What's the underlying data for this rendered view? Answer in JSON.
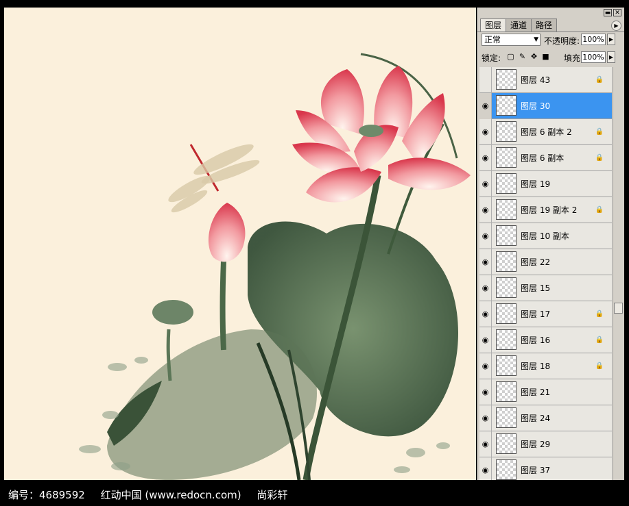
{
  "panel": {
    "tabs": [
      "图层",
      "通道",
      "路径"
    ],
    "blend_mode": "正常",
    "opacity_label": "不透明度:",
    "opacity_value": "100%",
    "lock_label": "锁定:",
    "fill_label": "填充:",
    "fill_value": "100%",
    "layers": [
      {
        "name": "图层 43",
        "visible": false,
        "selected": false,
        "locked": true
      },
      {
        "name": "图层 30",
        "visible": true,
        "selected": true,
        "locked": false
      },
      {
        "name": "图层 6 副本 2",
        "visible": true,
        "selected": false,
        "locked": true
      },
      {
        "name": "图层 6 副本",
        "visible": true,
        "selected": false,
        "locked": true
      },
      {
        "name": "图层 19",
        "visible": true,
        "selected": false,
        "locked": false
      },
      {
        "name": "图层 19 副本 2",
        "visible": true,
        "selected": false,
        "locked": true
      },
      {
        "name": "图层 10 副本",
        "visible": true,
        "selected": false,
        "locked": false
      },
      {
        "name": "图层 22",
        "visible": true,
        "selected": false,
        "locked": false
      },
      {
        "name": "图层 15",
        "visible": true,
        "selected": false,
        "locked": false
      },
      {
        "name": "图层 17",
        "visible": true,
        "selected": false,
        "locked": true
      },
      {
        "name": "图层 16",
        "visible": true,
        "selected": false,
        "locked": true
      },
      {
        "name": "图层 18",
        "visible": true,
        "selected": false,
        "locked": true
      },
      {
        "name": "图层 21",
        "visible": true,
        "selected": false,
        "locked": false
      },
      {
        "name": "图层 24",
        "visible": true,
        "selected": false,
        "locked": false
      },
      {
        "name": "图层 29",
        "visible": true,
        "selected": false,
        "locked": false
      },
      {
        "name": "图层 37",
        "visible": true,
        "selected": false,
        "locked": false
      }
    ]
  },
  "caption": {
    "id_text": "编号：4689592",
    "site_text": "红动中国 (www.redocn.com)",
    "author_text": "尚彩轩"
  },
  "colors": {
    "canvas_bg": "#fbf0dc",
    "selection": "#3b94f0",
    "lotus_pink": "#e35a67",
    "leaf_green": "#3f5a40"
  },
  "icons": {
    "eye": "eye-icon",
    "lock": "lock-icon",
    "panel_menu": "panel-menu-arrow-icon"
  }
}
